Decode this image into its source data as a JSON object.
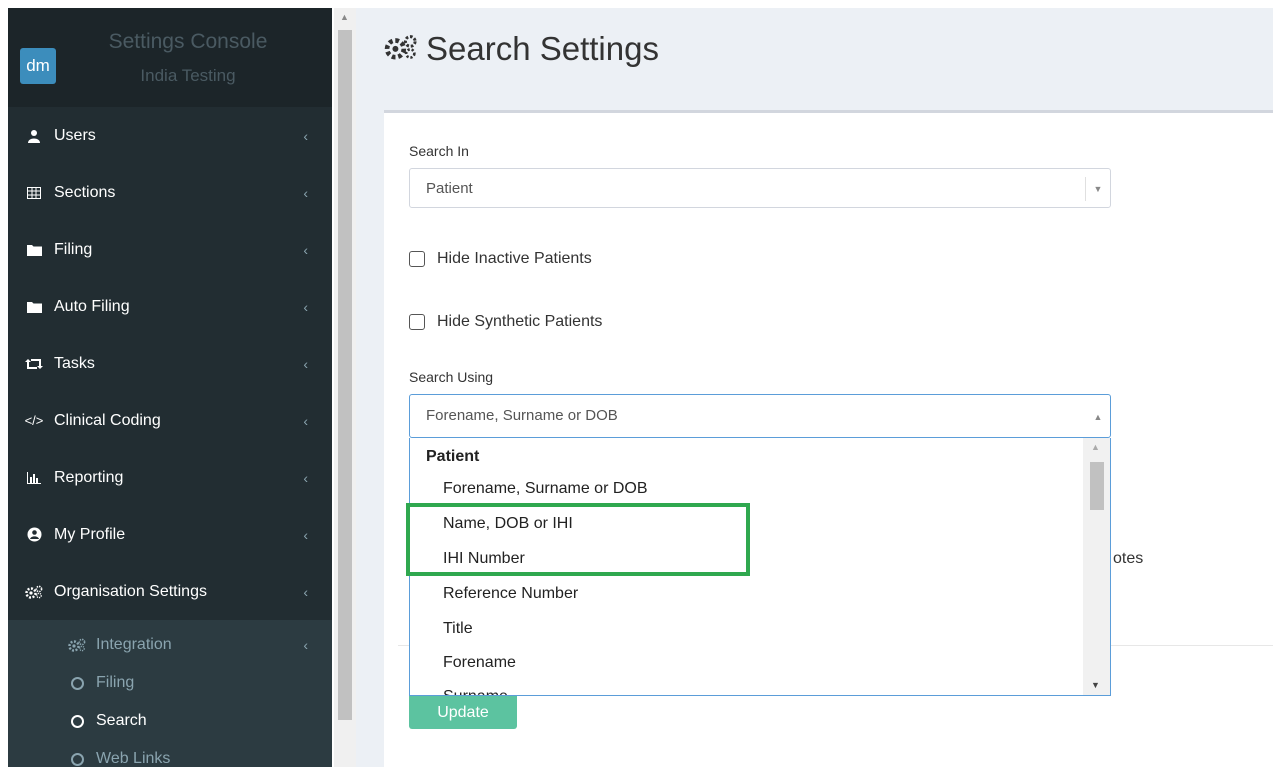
{
  "sidebar": {
    "brand": {
      "logo": "dm",
      "title": "Settings Console",
      "subtitle": "India Testing"
    },
    "items": [
      {
        "label": "Users",
        "icon": "user-icon"
      },
      {
        "label": "Sections",
        "icon": "table-icon"
      },
      {
        "label": "Filing",
        "icon": "folder-icon"
      },
      {
        "label": "Auto Filing",
        "icon": "folder-icon"
      },
      {
        "label": "Tasks",
        "icon": "retweet-icon"
      },
      {
        "label": "Clinical Coding",
        "icon": "code-icon"
      },
      {
        "label": "Reporting",
        "icon": "bar-chart-icon"
      },
      {
        "label": "My Profile",
        "icon": "user-circle-icon"
      },
      {
        "label": "Organisation Settings",
        "icon": "gears-icon"
      }
    ],
    "submenu": [
      {
        "label": "Integration",
        "icon": "gears-icon"
      },
      {
        "label": "Filing",
        "icon": "circle-icon"
      },
      {
        "label": "Search",
        "icon": "circle-icon",
        "active": true
      },
      {
        "label": "Web Links",
        "icon": "circle-icon"
      }
    ],
    "chevron": "‹"
  },
  "page": {
    "title": "Search Settings",
    "icon": "gears-icon"
  },
  "form": {
    "search_in": {
      "label": "Search In",
      "value": "Patient"
    },
    "checkboxes": [
      {
        "label": "Hide Inactive Patients",
        "checked": false
      },
      {
        "label": "Hide Synthetic Patients",
        "checked": false
      }
    ],
    "search_using": {
      "label": "Search Using",
      "value": "Forename, Surname or DOB"
    },
    "partial_text": "otes",
    "update_label": "Update"
  },
  "dropdown": {
    "group": "Patient",
    "options": [
      "Forename, Surname or DOB",
      "Name, DOB or IHI",
      "IHI Number",
      "Reference Number",
      "Title",
      "Forename",
      "Surname"
    ]
  },
  "colors": {
    "sidebar_bg": "#222d32",
    "submenu_bg": "#2c3b41",
    "brand": "#3c8dbc",
    "update_button": "#5cc3a0",
    "highlight": "#2fa84f",
    "focus": "#5b9dd9"
  }
}
